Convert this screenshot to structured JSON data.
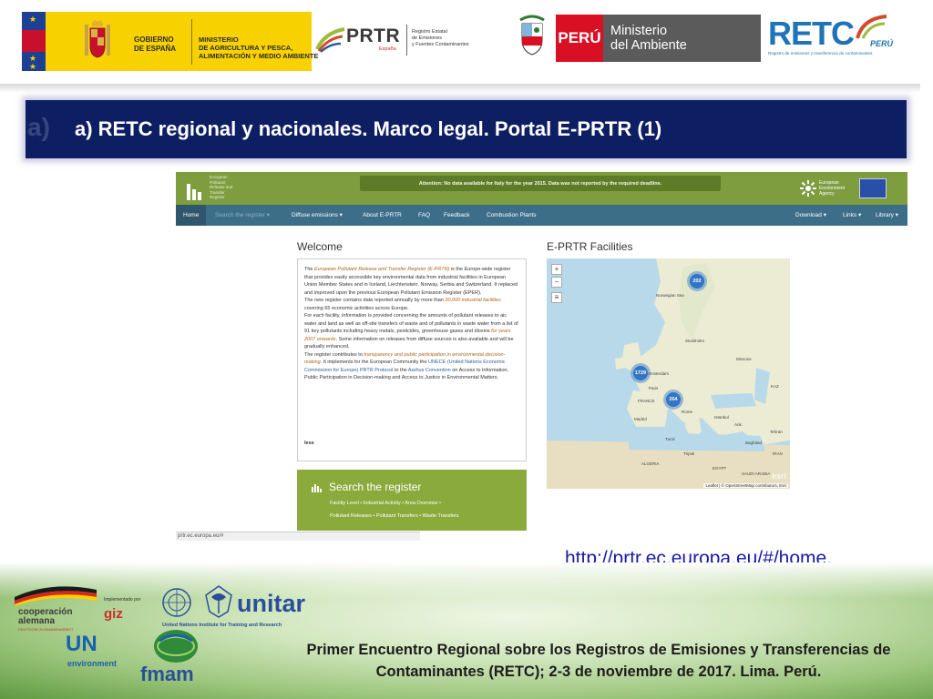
{
  "logos": {
    "gobierno": [
      "GOBIERNO",
      "DE ESPAÑA"
    ],
    "ministerio": [
      "MINISTERIO",
      "DE AGRICULTURA Y PESCA,",
      "ALIMENTACIÓN Y MEDIO AMBIENTE"
    ],
    "prtr_word": "PRTR",
    "prtr_sub": "España",
    "prtr_desc": [
      "Registro Estatal",
      "de Emisiones",
      "y Fuentes Contaminantes"
    ],
    "peru": "PERÚ",
    "minam": [
      "Ministerio",
      "del Ambiente"
    ],
    "retc_word": "RETC",
    "retc_peru": "PERÚ",
    "retc_sub": "Registro de emisiones y transferencia de contaminantes"
  },
  "slide": {
    "title_ghost": "a)",
    "title": "a) RETC regional y nacionales. Marco legal. Portal E-PRTR (1)",
    "url": "http://prtr.ec.europa.eu/#/home",
    "url_suffix": "."
  },
  "eprtr": {
    "logo_text": [
      "European",
      "Pollutant",
      "Release and",
      "Transfer",
      "Register"
    ],
    "attention": "Attention: No data available for Italy for the year 2015. Data was not reported by the required deadline.",
    "eea": [
      "European",
      "Environment",
      "Agency"
    ],
    "nav": [
      "Home",
      "Search the register ▾",
      "Diffuse emissions ▾",
      "About E-PRTR",
      "FAQ",
      "Feedback",
      "Combustion Plants"
    ],
    "nav_right": [
      "Download ▾",
      "Links ▾",
      "Library ▾"
    ],
    "welcome_heading": "Welcome",
    "welcome": {
      "p1a": "The ",
      "p1b": "European Pollutant Release and Transfer Register (E-PRTR)",
      "p1c": " is the Europe-wide register that provides easily accessible key environmental data from industrial facilities in European Union Member States and in Iceland, Liechtenstein, Norway, Serbia and Switzerland. It replaced and improved upon the previous European Pollutant Emission Register (EPER).",
      "p2a": "The new register contains data reported annually by more than ",
      "p2b": "30,000 industrial facilities",
      "p2c": " covering 65 economic activities across Europe.",
      "p3a": "For each facility, information is provided concerning the amounts of pollutant releases to air, water and land as well as off-site transfers of waste and of pollutants in waste water from a list of 91 key pollutants including heavy metals, pesticides, greenhouse gases and dioxins ",
      "p3b": "for years 2007 onwards",
      "p3c": ". Some information on releases from diffuse sources is also available and will be gradually enhanced.",
      "p4a": "The register contributes to ",
      "p4b": "transparency and public participation in environmental decision-making",
      "p4c": ". It implements for the European Community the ",
      "p4d": "UNECE (United Nations Economic Commission for Europe) PRTR Protocol",
      "p4e": " to the ",
      "p4f": "Aarhus Convention",
      "p4g": " on Access to Information, Public Participation in Decision-making and Access to Justice in Environmental Matters.",
      "less": "less"
    },
    "search_title": "Search the register",
    "search_links1": "Facility Level   •   Industrial Activity   •   Area Overview   •",
    "search_links2": "Pollutant Releases   •   Pollutant Transfers   •   Waste Transfers",
    "facilities_heading": "E-PRTR Facilities",
    "map_zoom": [
      "+",
      "−",
      "≡"
    ],
    "clusters": [
      "202",
      "1729",
      "264"
    ],
    "map_labels": [
      "Norwegian Sea",
      "Stockholm",
      "Moscow",
      "Amsterdam",
      "Paris",
      "FRANCE",
      "Madrid",
      "Istanbul",
      "Baghdad",
      "Tehran",
      "ALGERIA",
      "EGYPT",
      "SAUDI ARABIA",
      "Rome",
      "KAZ",
      "Ank.",
      "IRAN",
      "Tunis",
      "Tripoli"
    ],
    "map_esri": "esri",
    "map_attrib": "Leaflet | © OpenStreetMap contributors, Esri",
    "status_url": "prtr.ec.europa.eu/#"
  },
  "footer": {
    "coop": [
      "cooperación",
      "alemana"
    ],
    "coop_sub": "DEUTSCHE ZUSAMMENARBEIT",
    "implementado": "Implementado por",
    "giz": "giz",
    "unitar": "unitar",
    "unitar_sub": "United Nations Institute for Training and Research",
    "unenv": "UN",
    "unenv_sub": "environment",
    "fmam": "fmam",
    "text_line1": "Primer Encuentro Regional sobre los Registros de Emisiones y Transferencias de",
    "text_line2": "Contaminantes (RETC); 2-3 de noviembre de 2017. Lima. Perú."
  },
  "colors": {
    "title_bar": "#0d1e63",
    "eprtr_green": "#7d9d3e",
    "eprtr_nav": "#3c6e8a",
    "link": "#1a1aaa"
  }
}
